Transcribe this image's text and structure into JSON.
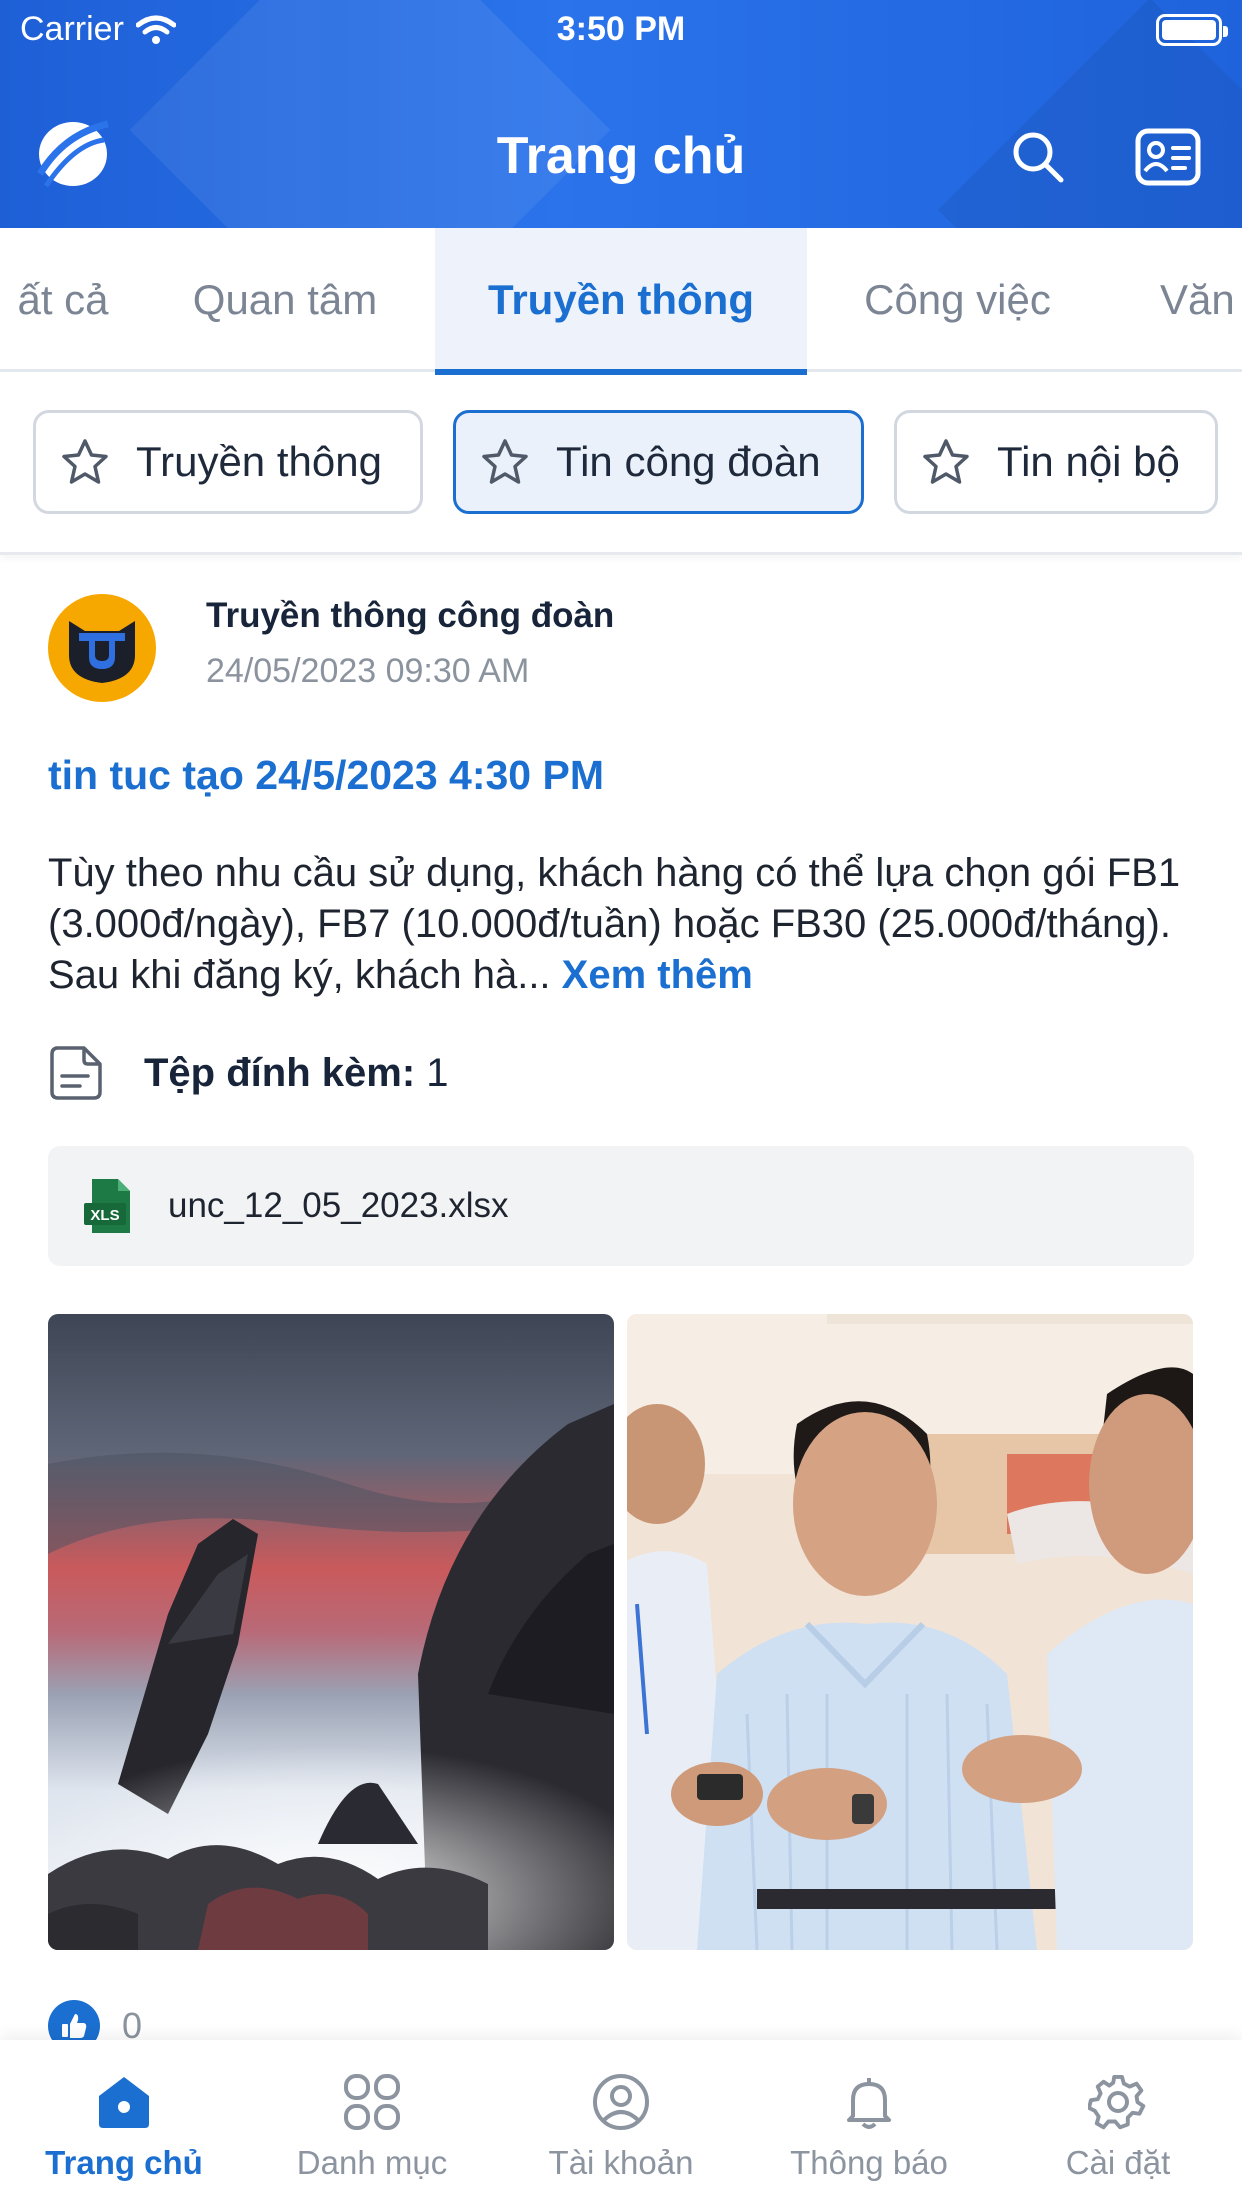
{
  "status_bar": {
    "carrier": "Carrier",
    "time": "3:50 PM"
  },
  "header": {
    "title": "Trang chủ"
  },
  "tabs": [
    {
      "label": "ất cả"
    },
    {
      "label": "Quan tâm"
    },
    {
      "label": "Truyền thông",
      "active": true
    },
    {
      "label": "Công việc"
    },
    {
      "label": "Văn"
    }
  ],
  "chips": [
    {
      "label": "Truyền thông"
    },
    {
      "label": "Tin công đoàn",
      "active": true
    },
    {
      "label": "Tin nội bộ"
    }
  ],
  "post": {
    "author": "Truyền thông công đoàn",
    "time": "24/05/2023 09:30 AM",
    "title": "tin tuc tạo 24/5/2023 4:30 PM",
    "body": "Tùy theo nhu cầu sử dụng, khách hàng có thể lựa chọn gói FB1 (3.000đ/ngày), FB7 (10.000đ/tuần) hoặc FB30 (25.000đ/tháng). Sau khi đăng ký, khách hà...",
    "more_label": " Xem thêm",
    "attachments_label": "Tệp đính kèm:",
    "attachments_count": "1",
    "file": {
      "type": "XLS",
      "name": "unc_12_05_2023.xlsx"
    },
    "likes": "0"
  },
  "bottom_nav": [
    {
      "label": "Trang chủ",
      "icon": "home-icon",
      "active": true
    },
    {
      "label": "Danh mục",
      "icon": "grid-icon"
    },
    {
      "label": "Tài khoản",
      "icon": "user-icon"
    },
    {
      "label": "Thông báo",
      "icon": "bell-icon"
    },
    {
      "label": "Cài đặt",
      "icon": "settings-icon"
    }
  ],
  "colors": {
    "primary": "#1b6fd0",
    "header": "#2a73ea",
    "avatar_bg": "#f7a800",
    "excel_green": "#1d7a45"
  }
}
